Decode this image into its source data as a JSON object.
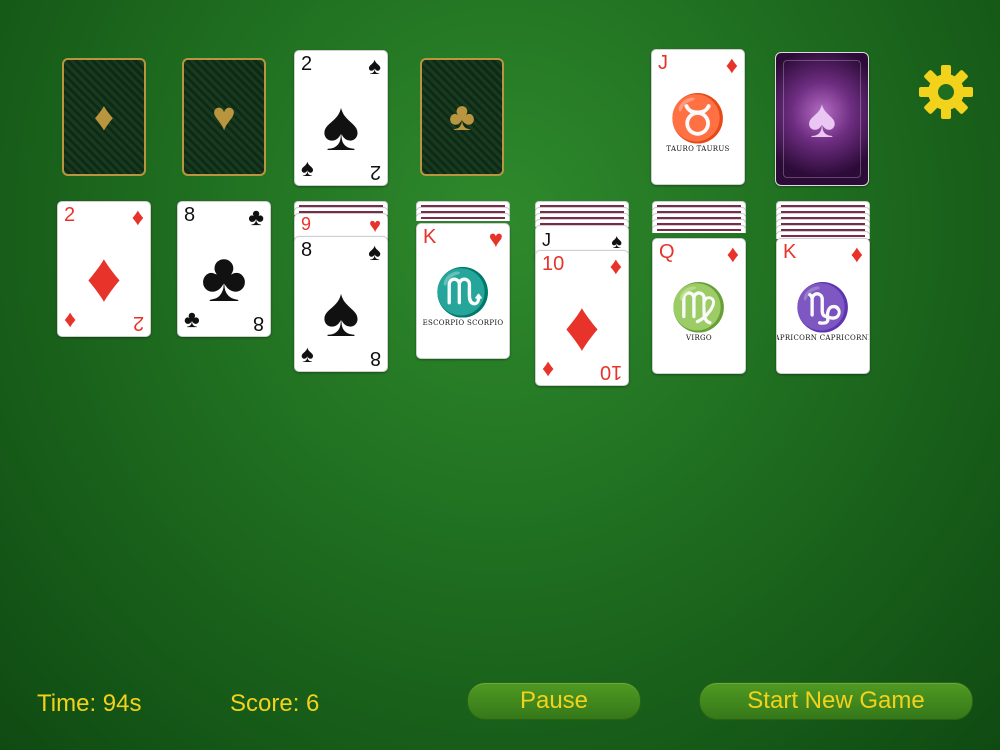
{
  "foundations": [
    {
      "suit": "♦",
      "name": "diamonds"
    },
    {
      "suit": "♥",
      "name": "hearts"
    },
    {
      "suit": "♣",
      "name": "clubs"
    }
  ],
  "foundation_card": {
    "rank": "2",
    "suit": "♠",
    "color": "#111111"
  },
  "waste_card": {
    "rank": "J",
    "suit": "♦",
    "color": "#e8332b",
    "art": "♉",
    "caption": "TAURO TAURUS"
  },
  "tableau": {
    "col1": {
      "rank": "2",
      "suit": "♦"
    },
    "col2": {
      "rank": "8",
      "suit": "♣"
    },
    "col3": {
      "hidden_rank": "9",
      "hidden_suit": "♥",
      "rank": "8",
      "suit": "♠"
    },
    "col4": {
      "rank": "K",
      "suit": "♥",
      "art": "♏",
      "caption": "ESCORPIO   SCORPIO"
    },
    "col5": {
      "hidden_rank": "J",
      "hidden_suit": "♠",
      "rank": "10",
      "suit": "♦"
    },
    "col6": {
      "rank": "Q",
      "suit": "♦",
      "art": "♍",
      "caption": "VIRGO"
    },
    "col7": {
      "rank": "K",
      "suit": "♦",
      "art": "♑",
      "caption": "CAPRICORN CAPRICORNIO"
    }
  },
  "hud": {
    "time": "Time: 94s",
    "score": "Score: 6"
  },
  "buttons": {
    "pause": "Pause",
    "new_game": "Start New Game"
  },
  "colors": {
    "felt": "#1f6e20",
    "accent_yellow": "#f3d21b",
    "red_suit": "#e8332b",
    "button": "#3f8a1e"
  },
  "icons": {
    "settings": "gear-icon",
    "stock_back": "spade-card-back"
  }
}
